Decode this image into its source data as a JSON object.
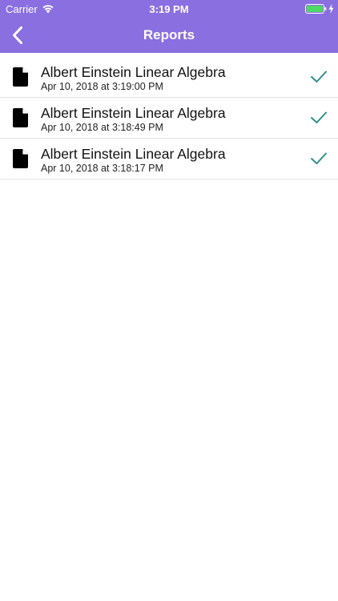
{
  "status_bar": {
    "carrier": "Carrier",
    "time": "3:19 PM",
    "icons": [
      "wifi-icon",
      "battery-icon",
      "charging-bolt-icon"
    ]
  },
  "nav": {
    "title": "Reports",
    "back_icon": "chevron-left-icon"
  },
  "colors": {
    "header_bg": "#8A6FE0",
    "check": "#2E8F8F",
    "battery": "#4CD964"
  },
  "reports": [
    {
      "title": "Albert Einstein Linear Algebra",
      "date": "Apr 10, 2018 at 3:19:00 PM",
      "icon": "document-icon",
      "status_icon": "checkmark-icon"
    },
    {
      "title": "Albert Einstein Linear Algebra",
      "date": "Apr 10, 2018 at 3:18:49 PM",
      "icon": "document-icon",
      "status_icon": "checkmark-icon"
    },
    {
      "title": "Albert Einstein Linear Algebra",
      "date": "Apr 10, 2018 at 3:18:17 PM",
      "icon": "document-icon",
      "status_icon": "checkmark-icon"
    }
  ]
}
